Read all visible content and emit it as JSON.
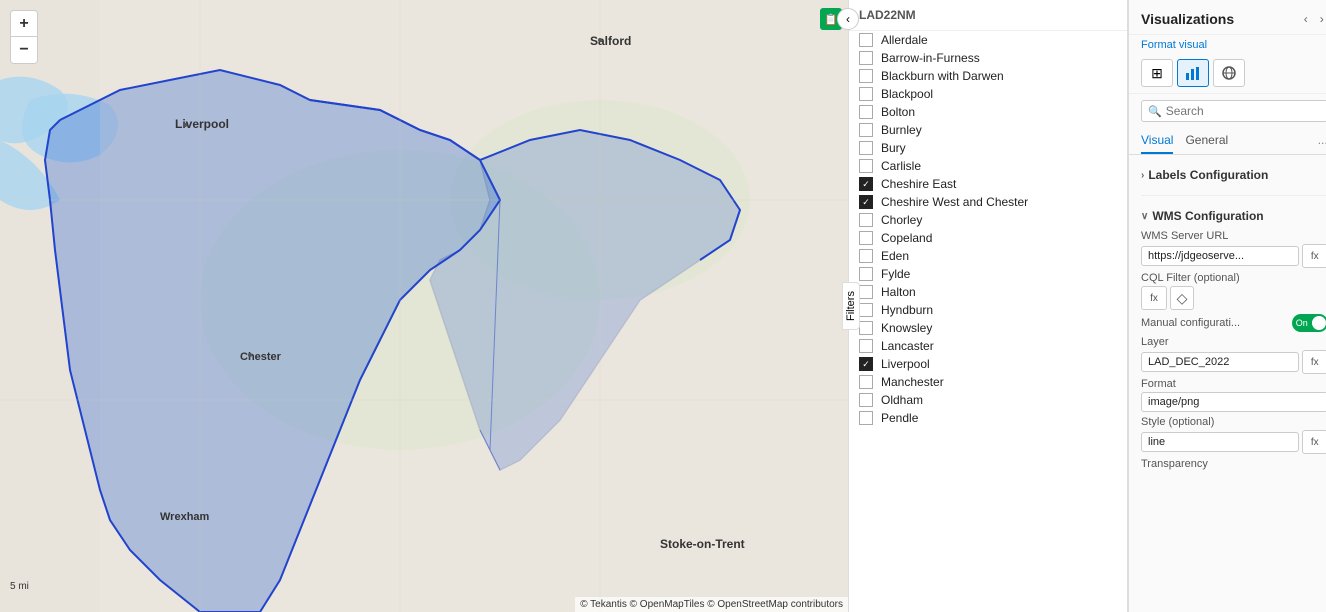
{
  "map": {
    "zoom_in": "+",
    "zoom_out": "−",
    "scale": "5 mi",
    "attribution": "© Tekantis © OpenMapTiles © OpenStreetMap contributors"
  },
  "filters": {
    "title": "LAD22NM",
    "collapse_label": "Filters",
    "items": [
      {
        "label": "Allerdale",
        "checked": false,
        "black": false
      },
      {
        "label": "Barrow-in-Furness",
        "checked": false,
        "black": false
      },
      {
        "label": "Blackburn with Darwen",
        "checked": false,
        "black": false
      },
      {
        "label": "Blackpool",
        "checked": false,
        "black": false
      },
      {
        "label": "Bolton",
        "checked": false,
        "black": false
      },
      {
        "label": "Burnley",
        "checked": false,
        "black": false
      },
      {
        "label": "Bury",
        "checked": false,
        "black": false
      },
      {
        "label": "Carlisle",
        "checked": false,
        "black": false
      },
      {
        "label": "Cheshire East",
        "checked": true,
        "black": true
      },
      {
        "label": "Cheshire West and Chester",
        "checked": true,
        "black": true
      },
      {
        "label": "Chorley",
        "checked": false,
        "black": false
      },
      {
        "label": "Copeland",
        "checked": false,
        "black": false
      },
      {
        "label": "Eden",
        "checked": false,
        "black": false
      },
      {
        "label": "Fylde",
        "checked": false,
        "black": false
      },
      {
        "label": "Halton",
        "checked": false,
        "black": false
      },
      {
        "label": "Hyndburn",
        "checked": false,
        "black": false
      },
      {
        "label": "Knowsley",
        "checked": false,
        "black": false
      },
      {
        "label": "Lancaster",
        "checked": false,
        "black": false
      },
      {
        "label": "Liverpool",
        "checked": true,
        "black": true
      },
      {
        "label": "Manchester",
        "checked": false,
        "black": false
      },
      {
        "label": "Oldham",
        "checked": false,
        "black": false
      },
      {
        "label": "Pendle",
        "checked": false,
        "black": false
      }
    ]
  },
  "visualizations": {
    "title": "Visualizations",
    "nav_back": "‹",
    "nav_forward": "›",
    "format_label": "Format visual",
    "icons": [
      {
        "name": "table-icon",
        "symbol": "⊞",
        "active": false
      },
      {
        "name": "chart-icon",
        "symbol": "📊",
        "active": true
      },
      {
        "name": "map-icon",
        "symbol": "🌐",
        "active": false
      }
    ],
    "search_placeholder": "Search",
    "tabs": [
      {
        "label": "Visual",
        "active": true
      },
      {
        "label": "General",
        "active": false
      }
    ],
    "tab_more": "...",
    "sections": {
      "labels": {
        "title": "Labels Configuration",
        "collapsed": true
      },
      "wms": {
        "title": "WMS Configuration",
        "collapsed": false,
        "fields": [
          {
            "label": "WMS Server URL",
            "value": "https://jdgeoserve...",
            "has_fx": true,
            "has_clear": false
          },
          {
            "label": "CQL Filter (optional)",
            "value": "",
            "has_fx": true,
            "has_clear": true
          }
        ],
        "toggle": {
          "label": "Manual configurati...",
          "state": "On"
        },
        "layer_field": {
          "label": "Layer",
          "value": "LAD_DEC_2022",
          "has_fx": true
        },
        "format_field": {
          "label": "Format",
          "value": "image/png",
          "has_fx": false
        },
        "style_field": {
          "label": "Style (optional)",
          "value": "line",
          "has_fx": true,
          "cursor_visible": true
        },
        "transparency_label": "Transparency"
      }
    }
  }
}
